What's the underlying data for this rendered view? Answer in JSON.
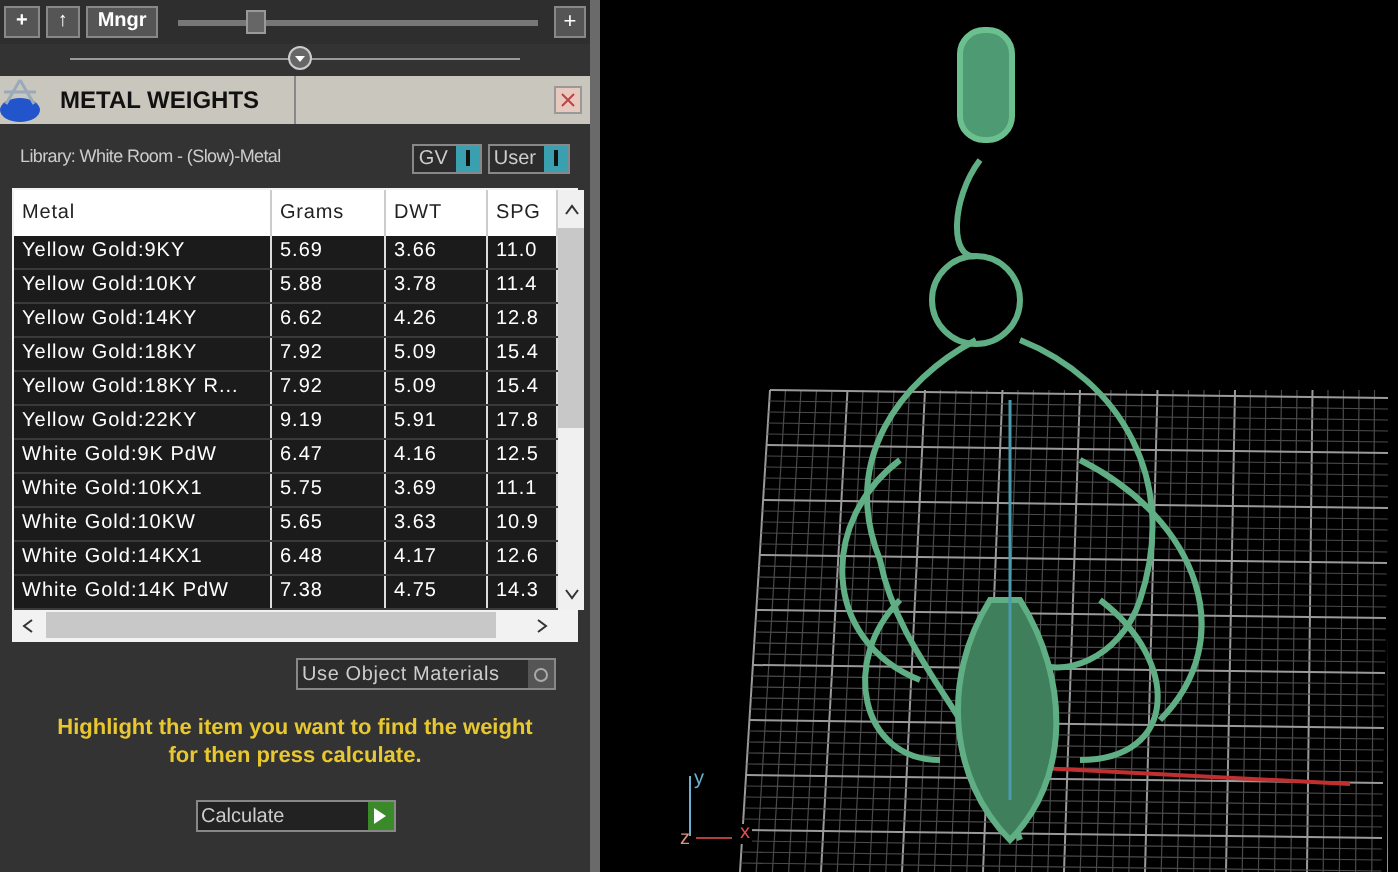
{
  "toolbar": {
    "buttons": [
      "+",
      "↑",
      "Mngr"
    ],
    "zoom_slider": {
      "level": 0.2
    },
    "add_button": "+"
  },
  "panel": {
    "title": "METAL WEIGHTS",
    "library": "Library: White Room - (Slow)-Metal",
    "toggles": [
      {
        "label": "GV",
        "on": true
      },
      {
        "label": "User",
        "on": true
      }
    ],
    "table": {
      "columns": [
        "Metal",
        "Grams",
        "DWT",
        "SPG"
      ],
      "rows": [
        {
          "cells": [
            "Yellow Gold:9KY",
            "5.69",
            "3.66",
            "11.0"
          ]
        },
        {
          "cells": [
            "Yellow Gold:10KY",
            "5.88",
            "3.78",
            "11.4"
          ]
        },
        {
          "cells": [
            "Yellow Gold:14KY",
            "6.62",
            "4.26",
            "12.8"
          ]
        },
        {
          "cells": [
            "Yellow Gold:18KY",
            "7.92",
            "5.09",
            "15.4"
          ]
        },
        {
          "cells": [
            "Yellow Gold:18KY R...",
            "7.92",
            "5.09",
            "15.4"
          ]
        },
        {
          "cells": [
            "Yellow Gold:22KY",
            "9.19",
            "5.91",
            "17.8"
          ]
        },
        {
          "cells": [
            "White Gold:9K PdW",
            "6.47",
            "4.16",
            "12.5"
          ]
        },
        {
          "cells": [
            "White Gold:10KX1",
            "5.75",
            "3.69",
            "11.1"
          ]
        },
        {
          "cells": [
            "White Gold:10KW",
            "5.65",
            "3.63",
            "10.9"
          ]
        },
        {
          "cells": [
            "White Gold:14KX1",
            "6.48",
            "4.17",
            "12.6"
          ]
        },
        {
          "cells": [
            "White Gold:14K PdW",
            "7.38",
            "4.75",
            "14.3"
          ]
        }
      ]
    },
    "use_object_materials": {
      "label": "Use Object Materials",
      "on": false
    },
    "hint": "Highlight the item you want to find the weight for then press calculate.",
    "calculate_button": "Calculate"
  },
  "viewport": {
    "axes": [
      "y",
      "z",
      "x"
    ]
  }
}
